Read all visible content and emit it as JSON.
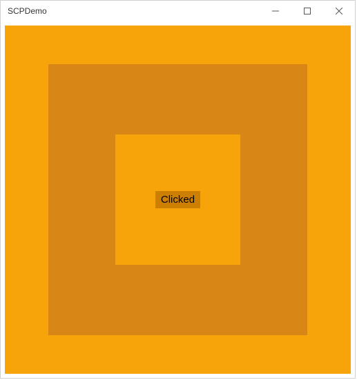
{
  "window": {
    "title": "SCPDemo"
  },
  "content": {
    "button_label": "Clicked"
  },
  "colors": {
    "outer": "#f7a30a",
    "mid": "#d88717",
    "inner": "#f7a30a",
    "button": "#cc7f00"
  }
}
